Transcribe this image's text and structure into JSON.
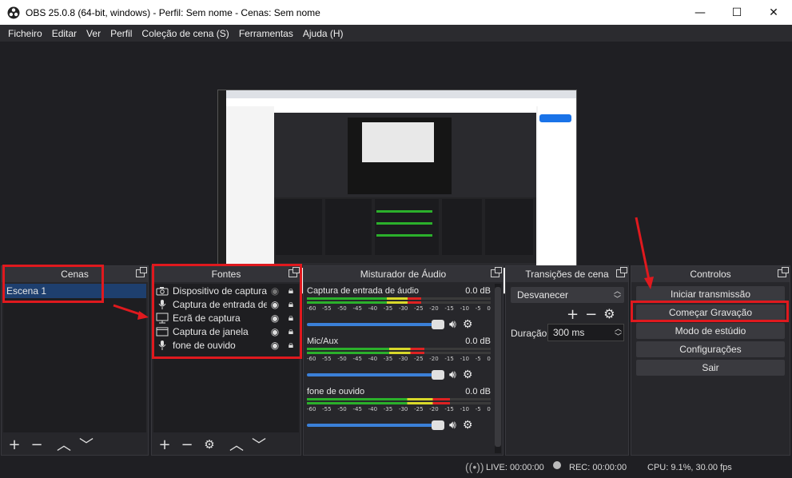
{
  "window": {
    "title": "OBS 25.0.8 (64-bit, windows) - Perfil: Sem nome - Cenas: Sem nome"
  },
  "window_controls": {
    "minimize": "—",
    "maximize": "☐",
    "close": "✕"
  },
  "menu": [
    "Ficheiro",
    "Editar",
    "Ver",
    "Perfil",
    "Coleção de cena (S)",
    "Ferramentas",
    "Ajuda (H)"
  ],
  "docks": {
    "scenes": {
      "title": "Cenas",
      "items": [
        "Escena 1"
      ]
    },
    "sources": {
      "title": "Fontes",
      "items": [
        {
          "label": "Dispositivo de captura de",
          "icon": "camera-icon",
          "visible": false
        },
        {
          "label": "Captura de entrada de",
          "icon": "microphone-icon",
          "visible": true
        },
        {
          "label": "Ecrã de captura",
          "icon": "monitor-icon",
          "visible": true
        },
        {
          "label": "Captura de janela",
          "icon": "window-icon",
          "visible": true
        },
        {
          "label": "fone de ouvido",
          "icon": "microphone-icon",
          "visible": true
        }
      ]
    },
    "mixer": {
      "title": "Misturador de Áudio",
      "scale": [
        "-60",
        "-55",
        "-50",
        "-45",
        "-40",
        "-35",
        "-30",
        "-25",
        "-20",
        "-15",
        "-10",
        "-5",
        "0"
      ],
      "channels": [
        {
          "name": "Captura de entrada de áudio",
          "db": "0.0 dB",
          "level": 0.62,
          "volume": 1.0
        },
        {
          "name": "Mic/Aux",
          "db": "0.0 dB",
          "level": 0.64,
          "volume": 1.0
        },
        {
          "name": "fone de ouvido",
          "db": "0.0 dB",
          "level": 0.78,
          "volume": 1.0
        }
      ]
    },
    "transitions": {
      "title": "Transições de cena",
      "selected": "Desvanecer",
      "duration_label": "Duração",
      "duration_value": "300 ms"
    },
    "controls": {
      "title": "Controlos",
      "buttons": [
        "Iniciar transmissão",
        "Começar Gravação",
        "Modo de estúdio",
        "Configurações",
        "Sair"
      ]
    }
  },
  "status": {
    "live": "LIVE: 00:00:00",
    "rec": "REC: 00:00:00",
    "cpu": "CPU: 9.1%, 30.00 fps"
  },
  "colors": {
    "annotation": "#e0191e",
    "selection": "#1e3f6e",
    "slider": "#3b80d8"
  }
}
